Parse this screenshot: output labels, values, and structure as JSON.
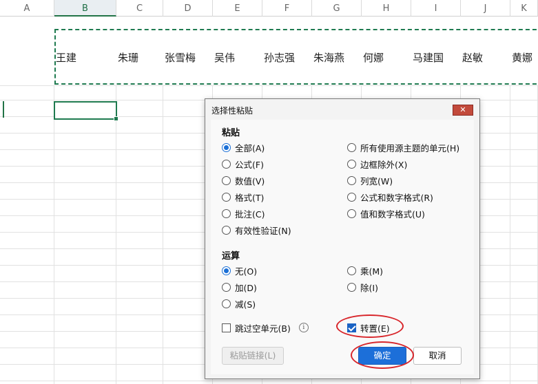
{
  "spreadsheet": {
    "columns": [
      {
        "name": "A",
        "selected": false
      },
      {
        "name": "B",
        "selected": true
      },
      {
        "name": "C",
        "selected": false
      },
      {
        "name": "D",
        "selected": false
      },
      {
        "name": "E",
        "selected": false
      },
      {
        "name": "F",
        "selected": false
      },
      {
        "name": "G",
        "selected": false
      },
      {
        "name": "H",
        "selected": false
      },
      {
        "name": "I",
        "selected": false
      },
      {
        "name": "J",
        "selected": false
      },
      {
        "name": "K",
        "selected": false
      }
    ],
    "row1_values": [
      "",
      "王建",
      "朱珊",
      "张雪梅",
      "吴伟",
      "孙志强",
      "朱海燕",
      "何娜",
      "马建国",
      "赵敏",
      "黄娜"
    ]
  },
  "dialog": {
    "title": "选择性粘贴",
    "close_label": "✕",
    "paste_section": "粘贴",
    "paste_options_left": [
      "全部(A)",
      "公式(F)",
      "数值(V)",
      "格式(T)",
      "批注(C)",
      "有效性验证(N)"
    ],
    "paste_options_right": [
      "所有使用源主题的单元(H)",
      "边框除外(X)",
      "列宽(W)",
      "公式和数字格式(R)",
      "值和数字格式(U)"
    ],
    "paste_selected": "全部(A)",
    "operation_section": "运算",
    "operation_left": [
      "无(O)",
      "加(D)",
      "减(S)"
    ],
    "operation_right": [
      "乘(M)",
      "除(I)"
    ],
    "operation_selected": "无(O)",
    "skip_blanks_label": "跳过空单元(B)",
    "skip_blanks_checked": false,
    "info_icon": "i",
    "transpose_label": "转置(E)",
    "transpose_checked": true,
    "paste_link_label": "粘贴链接(L)",
    "ok_label": "确定",
    "cancel_label": "取消"
  },
  "colors": {
    "accent": "#1c6fd9",
    "excel_green": "#1e7a4f",
    "highlight_red": "#d8262b"
  }
}
